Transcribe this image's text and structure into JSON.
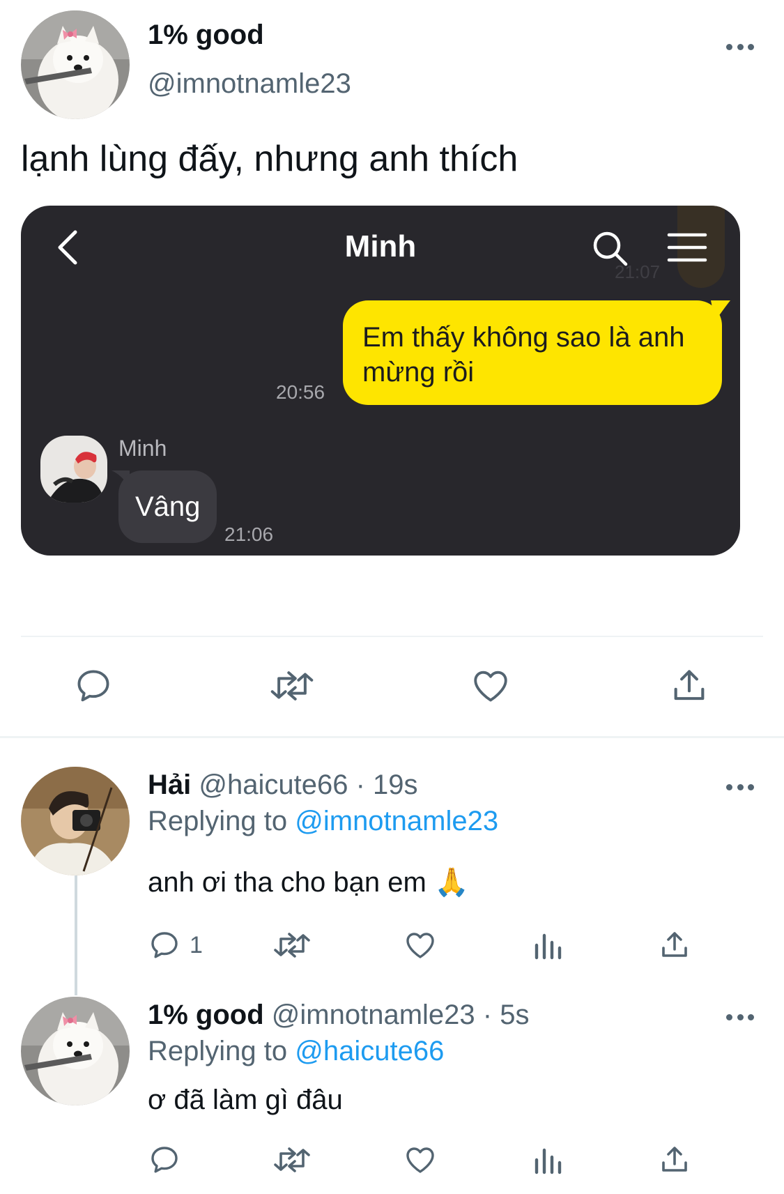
{
  "colors": {
    "text_primary": "#0f1419",
    "text_secondary": "#536471",
    "link": "#1d9bf0",
    "chat_bg": "#28272c",
    "bubble_out": "#fee500",
    "bubble_in": "#3b3a40"
  },
  "main_tweet": {
    "author_name": "1% good",
    "author_handle": "@imnotnamle23",
    "text": "lạnh lùng đấy, nhưng anh thích",
    "icons": {
      "more": "more-icon",
      "reply": "reply-icon",
      "retweet": "retweet-icon",
      "like": "heart-icon",
      "share": "share-icon"
    },
    "image": {
      "chat_title": "Minh",
      "ghost_time": "21:07",
      "outgoing_message": "Em thấy không sao là anh mừng rồi",
      "outgoing_time": "20:56",
      "sender_name": "Minh",
      "incoming_message": "Vâng",
      "incoming_time": "21:06"
    }
  },
  "replies": [
    {
      "author_name": "Hải",
      "author_handle": "@haicute66",
      "time": "· 19s",
      "replying_to_label": "Replying to",
      "replying_to": "@imnotnamle23",
      "text": "anh ơi tha cho bạn em 🙏",
      "reply_count": "1"
    },
    {
      "author_name": "1% good",
      "author_handle": "@imnotnamle23",
      "time": "· 5s",
      "replying_to_label": "Replying to",
      "replying_to": "@haicute66",
      "text": "ơ đã làm gì đâu",
      "reply_count": ""
    }
  ]
}
